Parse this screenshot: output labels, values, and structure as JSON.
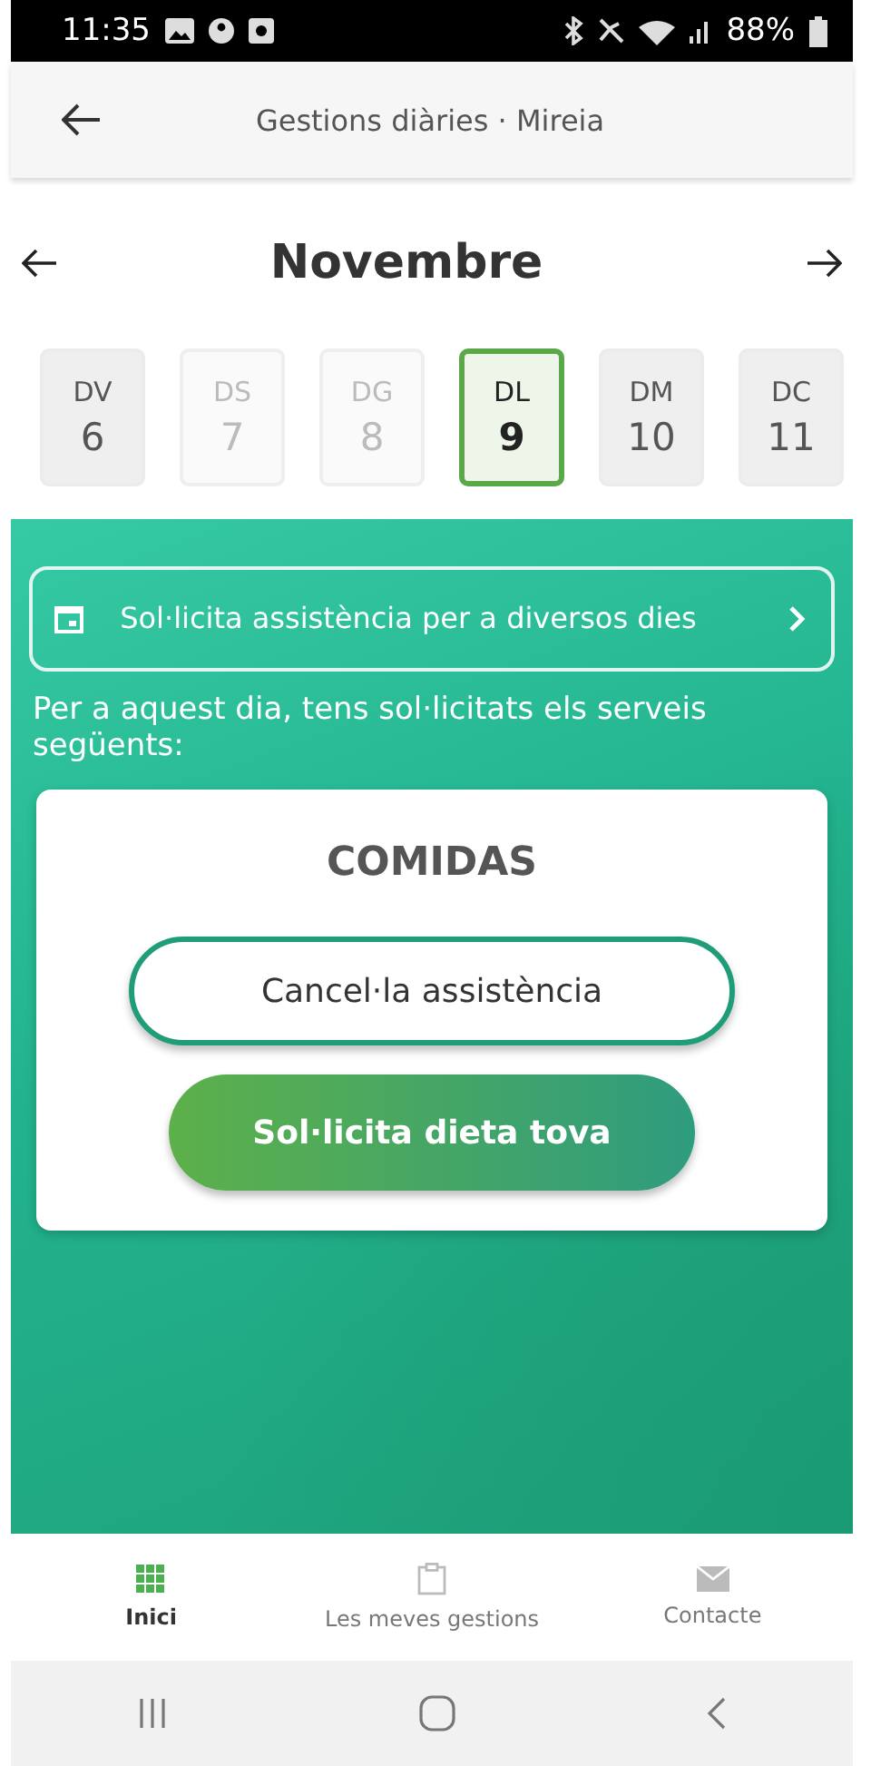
{
  "status_bar": {
    "time": "11:35",
    "battery": "88%"
  },
  "header": {
    "title": "Gestions diàries · Mireia"
  },
  "month": {
    "label": "Novembre"
  },
  "days": [
    {
      "weekday": "DV",
      "day": "6",
      "selected": false,
      "disabled": false
    },
    {
      "weekday": "DS",
      "day": "7",
      "selected": false,
      "disabled": true
    },
    {
      "weekday": "DG",
      "day": "8",
      "selected": false,
      "disabled": true
    },
    {
      "weekday": "DL",
      "day": "9",
      "selected": true,
      "disabled": false
    },
    {
      "weekday": "DM",
      "day": "10",
      "selected": false,
      "disabled": false
    },
    {
      "weekday": "DC",
      "day": "11",
      "selected": false,
      "disabled": false
    }
  ],
  "multi_day_button": {
    "label": "Sol·licita assistència per a diversos dies"
  },
  "intro": "Per a aquest dia, tens sol·licitats els serveis següents:",
  "service": {
    "title": "COMIDAS",
    "buttons": [
      {
        "kind": "outline",
        "label": "Cancel·la assistència"
      },
      {
        "kind": "filled",
        "label": "Sol·licita dieta tova"
      }
    ]
  },
  "bottom_nav": [
    {
      "label": "Inici",
      "selected": true
    },
    {
      "label": "Les meves gestions",
      "selected": false
    },
    {
      "label": "Contacte",
      "selected": false
    }
  ]
}
